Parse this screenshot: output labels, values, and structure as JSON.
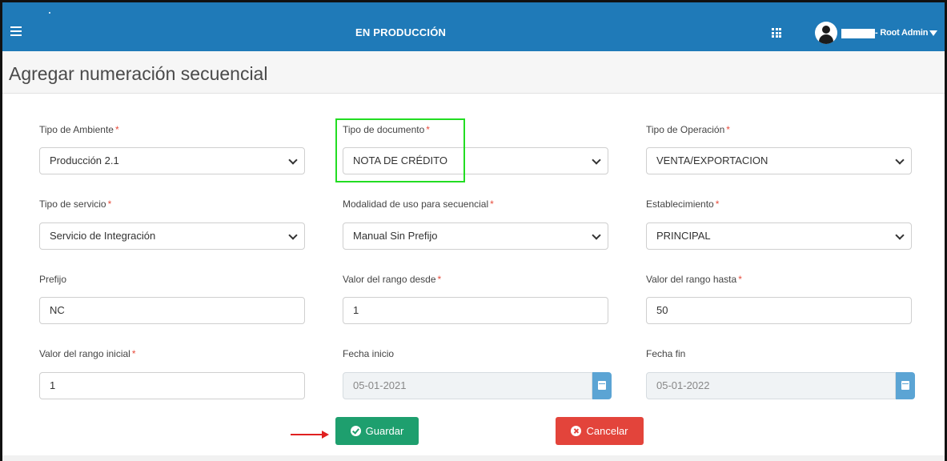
{
  "header": {
    "environment": "EN PRODUCCIÓN",
    "user": "- Root Admin"
  },
  "page": {
    "title": "Agregar numeración secuencial"
  },
  "form": {
    "tipo_ambiente": {
      "label": "Tipo de Ambiente",
      "value": "Producción 2.1"
    },
    "tipo_documento": {
      "label": "Tipo de documento",
      "value": "NOTA DE CRÉDITO"
    },
    "tipo_operacion": {
      "label": "Tipo de Operación",
      "value": "VENTA/EXPORTACION"
    },
    "tipo_servicio": {
      "label": "Tipo de servicio",
      "value": "Servicio de Integración"
    },
    "modalidad": {
      "label": "Modalidad de uso para secuencial",
      "value": "Manual Sin Prefijo"
    },
    "establecimiento": {
      "label": "Establecimiento",
      "value": "PRINCIPAL"
    },
    "prefijo": {
      "label": "Prefijo",
      "value": "NC"
    },
    "rango_desde": {
      "label": "Valor del rango desde",
      "value": "1"
    },
    "rango_hasta": {
      "label": "Valor del rango hasta",
      "value": "50"
    },
    "rango_inicial": {
      "label": "Valor del rango inicial",
      "value": "1"
    },
    "fecha_inicio": {
      "label": "Fecha inicio",
      "value": "05-01-2021"
    },
    "fecha_fin": {
      "label": "Fecha fin",
      "value": "05-01-2022"
    },
    "required_mark": "*"
  },
  "actions": {
    "save": "Guardar",
    "cancel": "Cancelar"
  },
  "colors": {
    "topbar": "#1f7ab8",
    "save": "#1e9f6e",
    "cancel": "#e3443b",
    "highlight": "#22dd22",
    "arrow": "#e02020"
  }
}
